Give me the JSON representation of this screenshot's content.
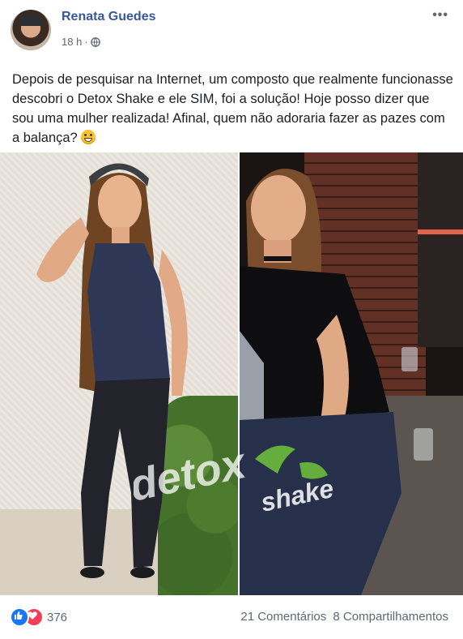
{
  "post": {
    "author": "Renata Guedes",
    "time": "18 h",
    "separator": "·",
    "privacy_icon": "globe-icon",
    "more_icon": "•••",
    "text": "Depois de pesquisar na Internet, um composto que realmente funcionasse descobri o Detox Shake e ele SIM, foi a solução! Hoje posso dizer que sou uma mulher realizada! Afinal, quem não adoraria fazer as pazes com a balança?",
    "emoji": "grinning-face-icon"
  },
  "image": {
    "watermark_left": "detox",
    "watermark_right": "shake"
  },
  "footer": {
    "reaction_icons": [
      "like-icon",
      "love-icon"
    ],
    "reaction_count": "376",
    "comments": "21 Comentários",
    "shares": "8 Compartilhamentos"
  },
  "colors": {
    "author": "#385898",
    "meta": "#606770",
    "like": "#1877f2",
    "love": "#f33e58",
    "watermark_green": "#6dbb3c"
  }
}
